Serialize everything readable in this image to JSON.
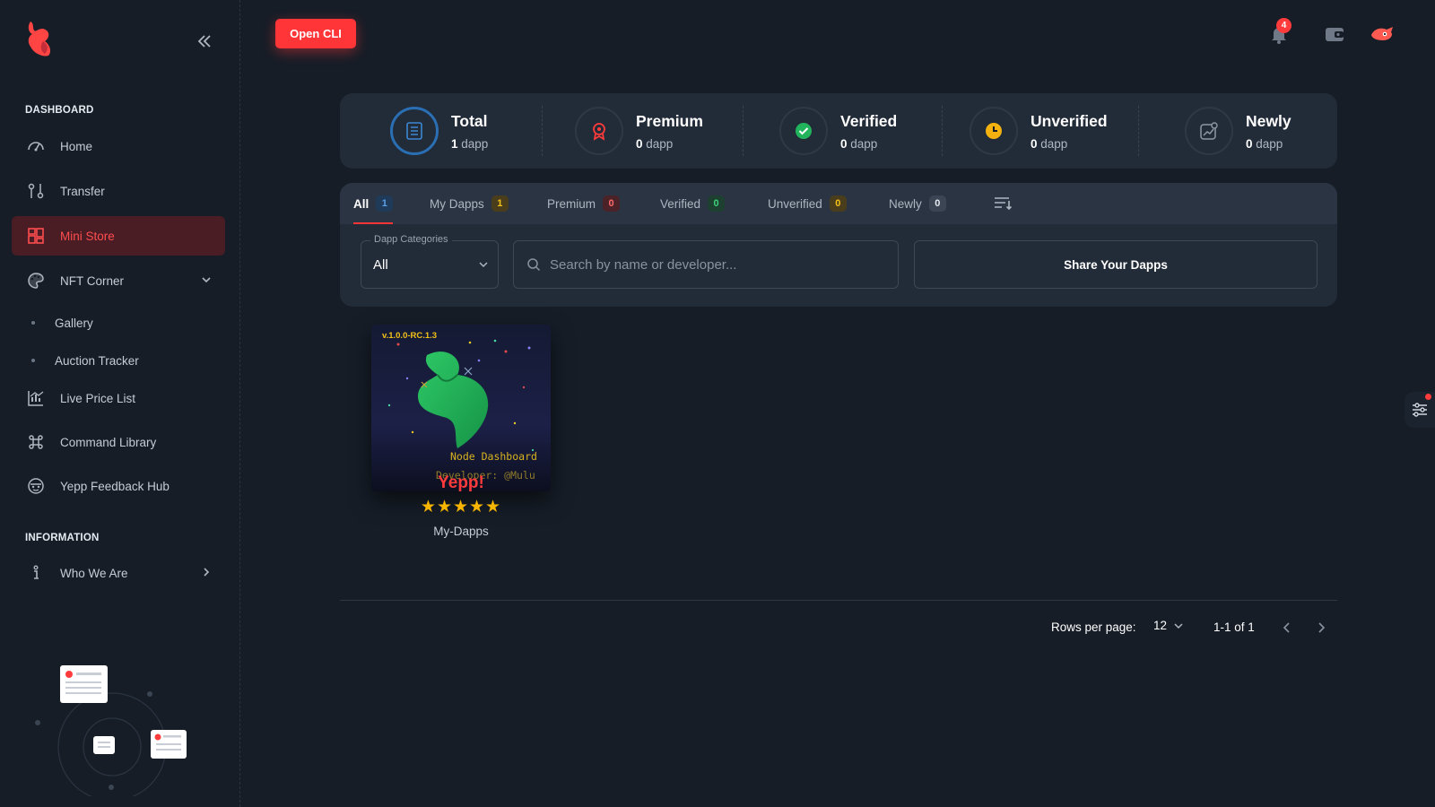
{
  "sidebar": {
    "section_dashboard": "DASHBOARD",
    "section_information": "INFORMATION",
    "items": [
      {
        "label": "Home",
        "icon": "gauge-icon"
      },
      {
        "label": "Transfer",
        "icon": "transfer-icon"
      },
      {
        "label": "Mini Store",
        "icon": "grid-icon",
        "active": true
      },
      {
        "label": "NFT Corner",
        "icon": "palette-icon"
      },
      {
        "label": "Live Price List",
        "icon": "chart-icon"
      },
      {
        "label": "Command Library",
        "icon": "command-icon"
      },
      {
        "label": "Yepp Feedback Hub",
        "icon": "feedback-icon"
      },
      {
        "label": "Who We Are",
        "icon": "info-icon"
      }
    ],
    "sub_items": [
      {
        "label": "Gallery"
      },
      {
        "label": "Auction Tracker"
      }
    ]
  },
  "topbar": {
    "open_cli_label": "Open CLI",
    "notification_count": "4"
  },
  "stats": [
    {
      "title": "Total",
      "count": "1",
      "unit": "dapp"
    },
    {
      "title": "Premium",
      "count": "0",
      "unit": "dapp"
    },
    {
      "title": "Verified",
      "count": "0",
      "unit": "dapp"
    },
    {
      "title": "Unverified",
      "count": "0",
      "unit": "dapp"
    },
    {
      "title": "Newly",
      "count": "0",
      "unit": "dapp"
    }
  ],
  "tabs": [
    {
      "label": "All",
      "count": "1"
    },
    {
      "label": "My Dapps",
      "count": "1"
    },
    {
      "label": "Premium",
      "count": "0"
    },
    {
      "label": "Verified",
      "count": "0"
    },
    {
      "label": "Unverified",
      "count": "0"
    },
    {
      "label": "Newly",
      "count": "0"
    }
  ],
  "filters": {
    "category_label": "Dapp Categories",
    "category_value": "All",
    "search_placeholder": "Search by name or developer...",
    "share_label": "Share Your Dapps"
  },
  "card": {
    "version": "v.1.0.0-RC.1.3",
    "overlay_title": "Node Dashboard",
    "overlay_developer": "Developer: @Mulu",
    "brand_text": "Yepp!",
    "stars": "★★★★★",
    "name": "My-Dapps"
  },
  "pagination": {
    "rows_label": "Rows per page:",
    "rows_value": "12",
    "range": "1-1 of 1"
  },
  "colors": {
    "accent": "#ff3538",
    "background": "#161d27",
    "panel": "#222b38"
  }
}
